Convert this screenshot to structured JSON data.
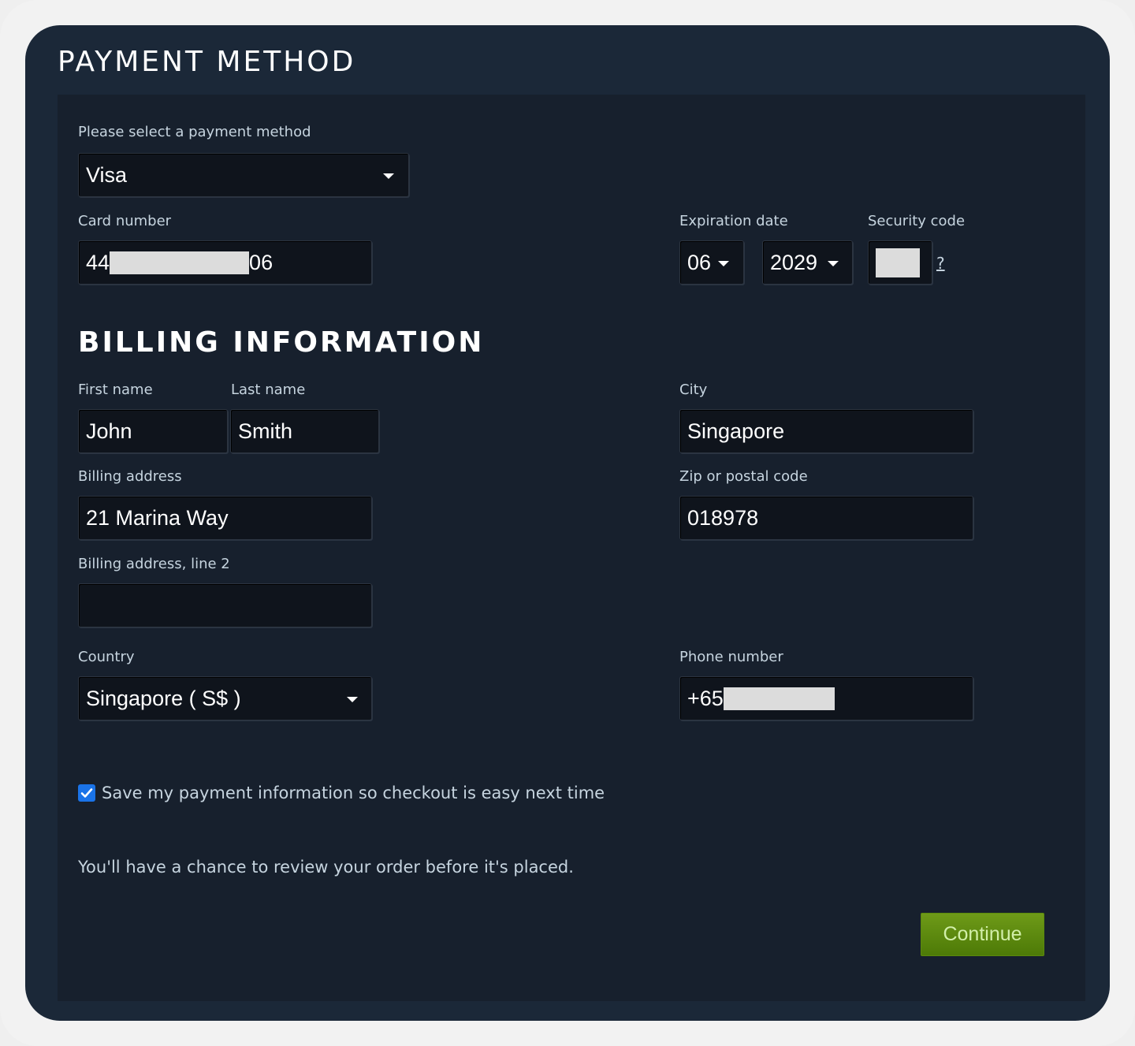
{
  "payment": {
    "title": "PAYMENT METHOD",
    "select_label": "Please select a payment method",
    "method_value": "Visa",
    "card_label": "Card number",
    "card_prefix": "44",
    "card_suffix": "06",
    "expiration_label": "Expiration date",
    "exp_month": "06",
    "exp_year": "2029",
    "security_label": "Security code",
    "help_link": "?"
  },
  "billing": {
    "title": "BILLING INFORMATION",
    "first_name_label": "First name",
    "first_name": "John",
    "last_name_label": "Last name",
    "last_name": "Smith",
    "city_label": "City",
    "city": "Singapore",
    "address_label": "Billing address",
    "address": "21 Marina Way",
    "zip_label": "Zip or postal code",
    "zip": "018978",
    "address2_label": "Billing address, line 2",
    "address2": "",
    "country_label": "Country",
    "country": "Singapore ( S$ )",
    "phone_label": "Phone number",
    "phone_prefix": "+65"
  },
  "save_info": {
    "checked": true,
    "label": "Save my payment information so checkout is easy next time"
  },
  "review_note": "You'll have a chance to review your order before it's placed.",
  "continue_label": "Continue",
  "colors": {
    "card_bg": "#1b2838",
    "panel_bg": "#17202d",
    "field_bg": "#0f141c",
    "label": "#c6d4df",
    "checkbox": "#1a73e8",
    "button_green": "#5b8a0c",
    "button_text": "#d2efa9"
  },
  "icons": {
    "dropdown": "caret-down-icon",
    "checkbox": "checkmark-icon"
  }
}
